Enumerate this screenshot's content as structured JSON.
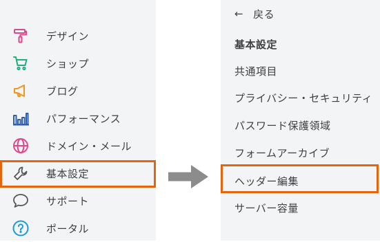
{
  "left_menu": {
    "items": [
      {
        "label": "デザイン",
        "icon": "paint-roller-icon",
        "color": "#e0468a"
      },
      {
        "label": "ショップ",
        "icon": "cart-icon",
        "color": "#1bb07a"
      },
      {
        "label": "ブログ",
        "icon": "megaphone-icon",
        "color": "#f0961e"
      },
      {
        "label": "パフォーマンス",
        "icon": "bar-chart-icon",
        "color": "#2b5eb0"
      },
      {
        "label": "ドメイン・メール",
        "icon": "globe-icon",
        "color": "#e0468a"
      },
      {
        "label": "基本設定",
        "icon": "wrench-icon",
        "color": "#555555",
        "highlighted": true
      },
      {
        "label": "サポート",
        "icon": "chat-bubble-icon",
        "color": "#555555"
      },
      {
        "label": "ポータル",
        "icon": "help-circle-icon",
        "color": "#1a9bd7"
      }
    ]
  },
  "right_menu": {
    "back_arrow": "←",
    "back_label": "戻る",
    "section_title": "基本設定",
    "items": [
      {
        "label": "共通項目"
      },
      {
        "label": "プライバシー・セキュリティ"
      },
      {
        "label": "パスワード保護領域"
      },
      {
        "label": "フォームアーカイブ"
      },
      {
        "label": "ヘッダー編集",
        "highlighted": true
      },
      {
        "label": "サーバー容量"
      }
    ]
  },
  "colors": {
    "highlight": "#e5650d",
    "arrow": "#8c8c8c",
    "panel_bg": "#f3f4f6",
    "text": "#3c4043"
  }
}
